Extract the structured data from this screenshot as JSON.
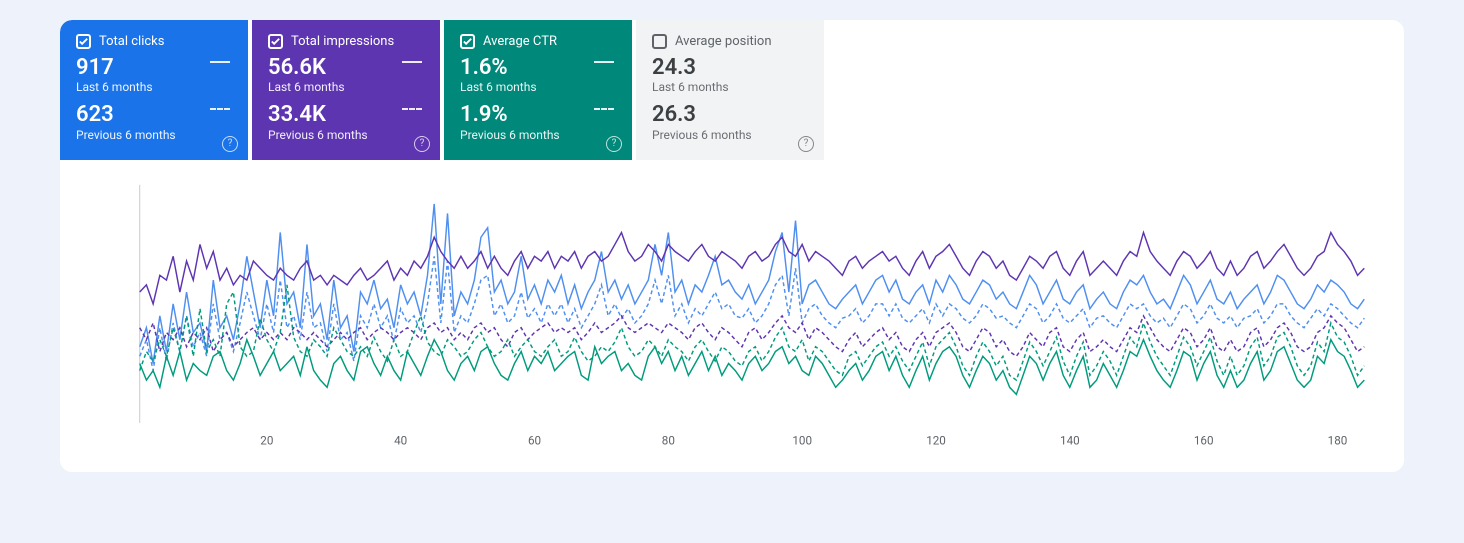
{
  "metrics": [
    {
      "id": "clicks",
      "title": "Total clicks",
      "checked": true,
      "color": "blue",
      "current_value": "917",
      "current_label": "Last 6 months",
      "previous_value": "623",
      "previous_label": "Previous 6 months"
    },
    {
      "id": "impressions",
      "title": "Total impressions",
      "checked": true,
      "color": "purple",
      "current_value": "56.6K",
      "current_label": "Last 6 months",
      "previous_value": "33.4K",
      "previous_label": "Previous 6 months"
    },
    {
      "id": "ctr",
      "title": "Average CTR",
      "checked": true,
      "color": "teal",
      "current_value": "1.6%",
      "current_label": "Last 6 months",
      "previous_value": "1.9%",
      "previous_label": "Previous 6 months"
    },
    {
      "id": "position",
      "title": "Average position",
      "checked": false,
      "color": "grey",
      "current_value": "24.3",
      "current_label": "Last 6 months",
      "previous_value": "26.3",
      "previous_label": "Previous 6 months"
    }
  ],
  "help_glyph": "?",
  "colors": {
    "blue_solid": "#4f8ff0",
    "blue_dashed": "#4f8ff0",
    "purple_solid": "#5e35b1",
    "purple_dashed": "#5e35b1",
    "teal_solid": "#009b7d",
    "teal_dashed": "#009b7d"
  },
  "chart_data": {
    "type": "line",
    "xlabel": "",
    "ylabel": "",
    "x_ticks": [
      20,
      40,
      60,
      80,
      100,
      120,
      140,
      160,
      180
    ],
    "ylim": [
      0,
      100
    ],
    "xlim": [
      1,
      184
    ],
    "series": [
      {
        "name": "Clicks – last 6 months",
        "color": "blue_solid",
        "style": "solid",
        "values": [
          32,
          40,
          25,
          45,
          30,
          50,
          35,
          55,
          38,
          42,
          30,
          60,
          40,
          45,
          35,
          50,
          70,
          55,
          40,
          60,
          45,
          80,
          50,
          55,
          40,
          75,
          45,
          50,
          35,
          60,
          40,
          45,
          30,
          55,
          50,
          60,
          48,
          52,
          40,
          58,
          50,
          55,
          45,
          62,
          92,
          50,
          88,
          45,
          55,
          50,
          60,
          78,
          82,
          55,
          60,
          50,
          55,
          70,
          52,
          58,
          50,
          60,
          55,
          62,
          50,
          58,
          48,
          55,
          60,
          72,
          55,
          60,
          52,
          58,
          50,
          55,
          60,
          75,
          62,
          80,
          55,
          60,
          50,
          58,
          55,
          62,
          70,
          58,
          60,
          55,
          52,
          58,
          50,
          55,
          60,
          72,
          80,
          55,
          85,
          50,
          58,
          60,
          55,
          50,
          48,
          52,
          55,
          58,
          50,
          55,
          60,
          62,
          55,
          60,
          52,
          50,
          55,
          58,
          50,
          60,
          55,
          62,
          58,
          52,
          50,
          55,
          60,
          58,
          52,
          55,
          50,
          48,
          55,
          62,
          58,
          50,
          55,
          60,
          52,
          50,
          55,
          58,
          48,
          52,
          55,
          50,
          48,
          55,
          60,
          58,
          62,
          55,
          50,
          52,
          48,
          55,
          62,
          58,
          50,
          55,
          60,
          52,
          50,
          55,
          48,
          52,
          55,
          58,
          50,
          55,
          62,
          60,
          55,
          50,
          48,
          52,
          58,
          55,
          60,
          58,
          55,
          50,
          48,
          52
        ]
      },
      {
        "name": "Clicks – previous 6 months",
        "color": "blue_dashed",
        "style": "dashed",
        "values": [
          28,
          35,
          22,
          40,
          26,
          42,
          30,
          45,
          32,
          38,
          28,
          50,
          35,
          38,
          30,
          42,
          55,
          45,
          35,
          50,
          38,
          60,
          40,
          45,
          35,
          55,
          40,
          42,
          30,
          50,
          35,
          38,
          26,
          45,
          40,
          50,
          40,
          45,
          34,
          48,
          42,
          45,
          38,
          50,
          70,
          42,
          68,
          38,
          45,
          42,
          50,
          60,
          62,
          45,
          50,
          42,
          45,
          55,
          44,
          48,
          42,
          50,
          45,
          50,
          42,
          48,
          40,
          45,
          50,
          58,
          45,
          50,
          44,
          48,
          42,
          45,
          50,
          60,
          50,
          62,
          45,
          50,
          42,
          48,
          45,
          50,
          55,
          48,
          50,
          45,
          44,
          48,
          42,
          45,
          50,
          58,
          62,
          45,
          65,
          42,
          48,
          50,
          45,
          42,
          40,
          44,
          45,
          48,
          42,
          45,
          50,
          50,
          45,
          50,
          44,
          42,
          45,
          48,
          42,
          50,
          45,
          50,
          48,
          44,
          42,
          45,
          50,
          48,
          44,
          45,
          42,
          40,
          45,
          50,
          48,
          42,
          45,
          50,
          44,
          42,
          45,
          48,
          40,
          44,
          45,
          42,
          40,
          45,
          50,
          48,
          50,
          45,
          42,
          44,
          40,
          45,
          50,
          48,
          42,
          45,
          50,
          44,
          42,
          45,
          40,
          44,
          45,
          48,
          42,
          45,
          50,
          50,
          45,
          42,
          40,
          44,
          48,
          45,
          50,
          48,
          45,
          42,
          40,
          44
        ]
      },
      {
        "name": "Impressions – last 6 months",
        "color": "purple_solid",
        "style": "solid",
        "values": [
          55,
          58,
          50,
          62,
          60,
          70,
          55,
          68,
          60,
          75,
          65,
          72,
          60,
          65,
          58,
          62,
          60,
          68,
          65,
          62,
          60,
          65,
          62,
          60,
          65,
          68,
          60,
          62,
          58,
          62,
          60,
          58,
          62,
          65,
          60,
          62,
          65,
          68,
          60,
          65,
          62,
          68,
          65,
          70,
          78,
          72,
          68,
          65,
          70,
          65,
          68,
          72,
          65,
          70,
          65,
          62,
          68,
          72,
          65,
          70,
          68,
          72,
          65,
          70,
          68,
          72,
          65,
          70,
          72,
          68,
          70,
          75,
          80,
          72,
          68,
          70,
          75,
          72,
          68,
          75,
          72,
          70,
          68,
          72,
          75,
          70,
          68,
          72,
          70,
          68,
          65,
          70,
          72,
          68,
          70,
          75,
          78,
          72,
          70,
          75,
          68,
          72,
          70,
          68,
          65,
          62,
          68,
          70,
          65,
          68,
          70,
          72,
          68,
          70,
          65,
          62,
          68,
          72,
          65,
          70,
          72,
          75,
          70,
          65,
          62,
          68,
          72,
          70,
          65,
          68,
          62,
          60,
          65,
          70,
          68,
          65,
          70,
          72,
          65,
          62,
          68,
          72,
          62,
          65,
          68,
          65,
          62,
          68,
          72,
          70,
          80,
          72,
          68,
          65,
          62,
          68,
          72,
          70,
          65,
          68,
          72,
          65,
          62,
          68,
          62,
          65,
          70,
          72,
          65,
          68,
          72,
          75,
          70,
          65,
          62,
          65,
          70,
          72,
          80,
          75,
          72,
          68,
          62,
          65
        ]
      },
      {
        "name": "Impressions – previous 6 months",
        "color": "purple_dashed",
        "style": "dashed",
        "values": [
          40,
          35,
          42,
          30,
          38,
          35,
          40,
          32,
          38,
          35,
          40,
          30,
          35,
          38,
          32,
          35,
          38,
          40,
          35,
          38,
          35,
          38,
          35,
          40,
          38,
          35,
          38,
          35,
          32,
          35,
          38,
          35,
          38,
          40,
          35,
          38,
          40,
          38,
          35,
          38,
          40,
          38,
          35,
          40,
          42,
          38,
          40,
          35,
          38,
          35,
          40,
          42,
          38,
          40,
          35,
          32,
          38,
          40,
          35,
          38,
          40,
          42,
          38,
          40,
          38,
          40,
          35,
          38,
          42,
          38,
          40,
          42,
          45,
          40,
          38,
          40,
          42,
          40,
          38,
          42,
          40,
          38,
          35,
          40,
          42,
          38,
          35,
          40,
          38,
          35,
          32,
          38,
          40,
          35,
          38,
          42,
          45,
          40,
          38,
          42,
          35,
          40,
          38,
          35,
          32,
          30,
          35,
          38,
          32,
          35,
          38,
          40,
          35,
          38,
          32,
          30,
          35,
          38,
          32,
          38,
          40,
          42,
          38,
          32,
          30,
          35,
          40,
          38,
          32,
          35,
          30,
          28,
          32,
          38,
          35,
          32,
          38,
          40,
          32,
          30,
          35,
          38,
          30,
          32,
          35,
          32,
          30,
          35,
          40,
          38,
          45,
          40,
          35,
          32,
          30,
          35,
          40,
          38,
          32,
          35,
          40,
          32,
          30,
          35,
          30,
          32,
          38,
          40,
          32,
          35,
          40,
          42,
          38,
          32,
          30,
          32,
          38,
          40,
          45,
          42,
          40,
          35,
          30,
          32
        ]
      },
      {
        "name": "CTR – last 6 months",
        "color": "teal_solid",
        "style": "solid",
        "values": [
          25,
          18,
          22,
          15,
          28,
          20,
          30,
          18,
          25,
          22,
          20,
          28,
          30,
          22,
          18,
          25,
          35,
          28,
          20,
          25,
          30,
          22,
          25,
          28,
          20,
          32,
          22,
          18,
          15,
          25,
          28,
          22,
          18,
          30,
          32,
          25,
          20,
          28,
          22,
          18,
          30,
          25,
          20,
          28,
          35,
          30,
          22,
          18,
          25,
          28,
          22,
          30,
          32,
          25,
          20,
          18,
          25,
          30,
          22,
          28,
          25,
          30,
          22,
          25,
          28,
          30,
          20,
          18,
          32,
          25,
          28,
          30,
          22,
          25,
          20,
          18,
          28,
          32,
          25,
          30,
          22,
          28,
          20,
          25,
          30,
          22,
          28,
          20,
          25,
          22,
          18,
          25,
          28,
          22,
          25,
          30,
          32,
          25,
          28,
          22,
          20,
          28,
          25,
          20,
          15,
          18,
          22,
          25,
          18,
          22,
          28,
          30,
          22,
          28,
          20,
          15,
          22,
          28,
          18,
          25,
          30,
          32,
          28,
          20,
          15,
          22,
          28,
          25,
          18,
          22,
          15,
          12,
          20,
          28,
          25,
          18,
          25,
          30,
          20,
          15,
          22,
          28,
          15,
          18,
          25,
          20,
          15,
          22,
          30,
          28,
          35,
          28,
          22,
          18,
          15,
          22,
          30,
          28,
          18,
          25,
          30,
          20,
          15,
          22,
          15,
          18,
          25,
          30,
          18,
          22,
          30,
          32,
          25,
          18,
          15,
          18,
          28,
          25,
          35,
          30,
          28,
          22,
          15,
          18
        ]
      },
      {
        "name": "CTR – previous 6 months",
        "color": "teal_dashed",
        "style": "dashed",
        "values": [
          22,
          30,
          26,
          35,
          28,
          40,
          30,
          45,
          28,
          48,
          30,
          35,
          28,
          50,
          55,
          32,
          28,
          30,
          44,
          35,
          30,
          38,
          58,
          36,
          30,
          28,
          35,
          32,
          28,
          40,
          35,
          30,
          28,
          32,
          28,
          36,
          30,
          26,
          35,
          28,
          30,
          38,
          45,
          34,
          30,
          28,
          35,
          32,
          28,
          30,
          35,
          38,
          32,
          28,
          30,
          35,
          28,
          32,
          35,
          30,
          28,
          32,
          35,
          28,
          30,
          36,
          30,
          26,
          28,
          32,
          30,
          34,
          40,
          32,
          28,
          30,
          35,
          32,
          28,
          35,
          32,
          30,
          26,
          32,
          35,
          30,
          26,
          32,
          30,
          26,
          24,
          30,
          32,
          26,
          30,
          36,
          40,
          32,
          30,
          35,
          26,
          32,
          30,
          26,
          22,
          20,
          28,
          30,
          24,
          28,
          32,
          34,
          28,
          32,
          26,
          22,
          28,
          34,
          24,
          32,
          35,
          38,
          32,
          24,
          20,
          28,
          34,
          30,
          24,
          28,
          20,
          18,
          26,
          34,
          30,
          24,
          30,
          36,
          26,
          20,
          28,
          34,
          20,
          24,
          30,
          26,
          20,
          28,
          36,
          32,
          42,
          34,
          28,
          24,
          20,
          28,
          36,
          32,
          24,
          30,
          36,
          26,
          20,
          28,
          20,
          24,
          32,
          36,
          24,
          28,
          36,
          38,
          32,
          24,
          20,
          24,
          34,
          30,
          42,
          36,
          34,
          28,
          20,
          24
        ]
      }
    ]
  }
}
